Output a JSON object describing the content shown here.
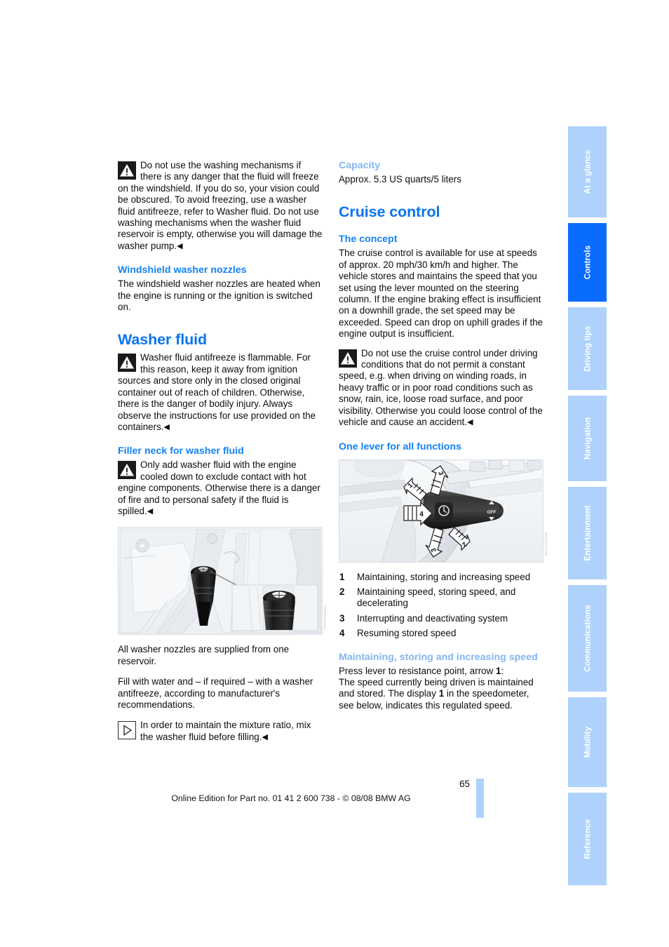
{
  "page": {
    "number": "65",
    "footer_line": "Online Edition for Part no. 01 41 2 600 738 - © 08/08 BMW AG"
  },
  "side_tabs": [
    {
      "label": "At a glance",
      "active": false
    },
    {
      "label": "Controls",
      "active": true
    },
    {
      "label": "Driving tips",
      "active": false
    },
    {
      "label": "Navigation",
      "active": false
    },
    {
      "label": "Entertainment",
      "active": false
    },
    {
      "label": "Communications",
      "active": false
    },
    {
      "label": "Mobility",
      "active": false
    },
    {
      "label": "Reference",
      "active": false
    }
  ],
  "left_column": {
    "warning_washing_mechanisms": "Do not use the washing mechanisms if there is any danger that the fluid will freeze on the windshield. If you do so, your vision could be obscured. To avoid freezing, use a washer fluid antifreeze, refer to Washer fluid. Do not use washing mechanisms when the washer fluid reservoir is empty, otherwise you will damage the washer pump.",
    "nozzles_heading": "Windshield washer nozzles",
    "nozzles_text": "The windshield washer nozzles are heated when the engine is running or the ignition is switched on.",
    "washer_fluid_heading": "Washer fluid",
    "warning_antifreeze": "Washer fluid antifreeze is flammable. For this reason, keep it away from ignition sources and store only in the closed original container out of reach of children. Otherwise, there is the danger of bodily injury. Always observe the instructions for use provided on the containers.",
    "filler_neck_heading": "Filler neck for washer fluid",
    "warning_filler_neck": "Only add washer fluid with the engine cooled down to exclude contact with hot engine components. Otherwise there is a danger of fire and to personal safety if the fluid is spilled.",
    "figure_caption_code": "WRS17PAT95A",
    "text_one_reservoir": "All washer nozzles are supplied from one reservoir.",
    "text_fill_with_water": "Fill with water and – if required – with a washer antifreeze, according to manufacturer's recommendations.",
    "note_mixture_ratio": "In order to maintain the mixture ratio, mix the washer fluid before filling."
  },
  "right_column": {
    "capacity_heading": "Capacity",
    "capacity_text": "Approx. 5.3 US quarts/5 liters",
    "cruise_control_heading": "Cruise control",
    "the_concept_heading": "The concept",
    "the_concept_text": "The cruise control is available for use at speeds of approx. 20 mph/30 km/h and higher. The vehicle stores and maintains the speed that you set using the lever mounted on the steering column. If the engine braking effect is insufficient on a downhill grade, the set speed may be exceeded. Speed can drop on uphill grades if the engine output is insufficient.",
    "warning_cruise_control": "Do not use the cruise control under driving conditions that do not permit a constant speed, e.g. when driving on winding roads, in heavy traffic or in poor road conditions such as snow, rain, ice, loose road surface, and poor visibility. Otherwise you could loose control of the vehicle and cause an accident.",
    "one_lever_heading": "One lever for all functions",
    "figure_caption_code": "WCS1CUT1091",
    "lever_functions": [
      {
        "num": "1",
        "label": "Maintaining, storing and increasing speed"
      },
      {
        "num": "2",
        "label": "Maintaining speed, storing speed, and decelerating"
      },
      {
        "num": "3",
        "label": "Interrupting and deactivating system"
      },
      {
        "num": "4",
        "label": "Resuming stored speed"
      }
    ],
    "maintaining_heading": "Maintaining, storing and increasing speed",
    "maintaining_line1_pre": "Press lever to resistance point, arrow ",
    "maintaining_line1_bold": "1",
    "maintaining_line1_post": ":",
    "maintaining_line2_pre": "The speed currently being driven is maintained and stored. The display ",
    "maintaining_line2_bold": "1",
    "maintaining_line2_post": " in the speedometer, see below, indicates this regulated speed."
  },
  "lever_figure": {
    "off_label": "OFF",
    "callouts": [
      "1",
      "2",
      "3",
      "3",
      "4"
    ]
  },
  "colors": {
    "heading_blue": "#0a74f0",
    "subheading_blue": "#1382f5",
    "pale_blue": "#84b5ef",
    "tab_inactive": "#aed2fb",
    "tab_active": "#0a6bff",
    "body_text": "#0d0d0d"
  },
  "endmark_glyph": "◀"
}
